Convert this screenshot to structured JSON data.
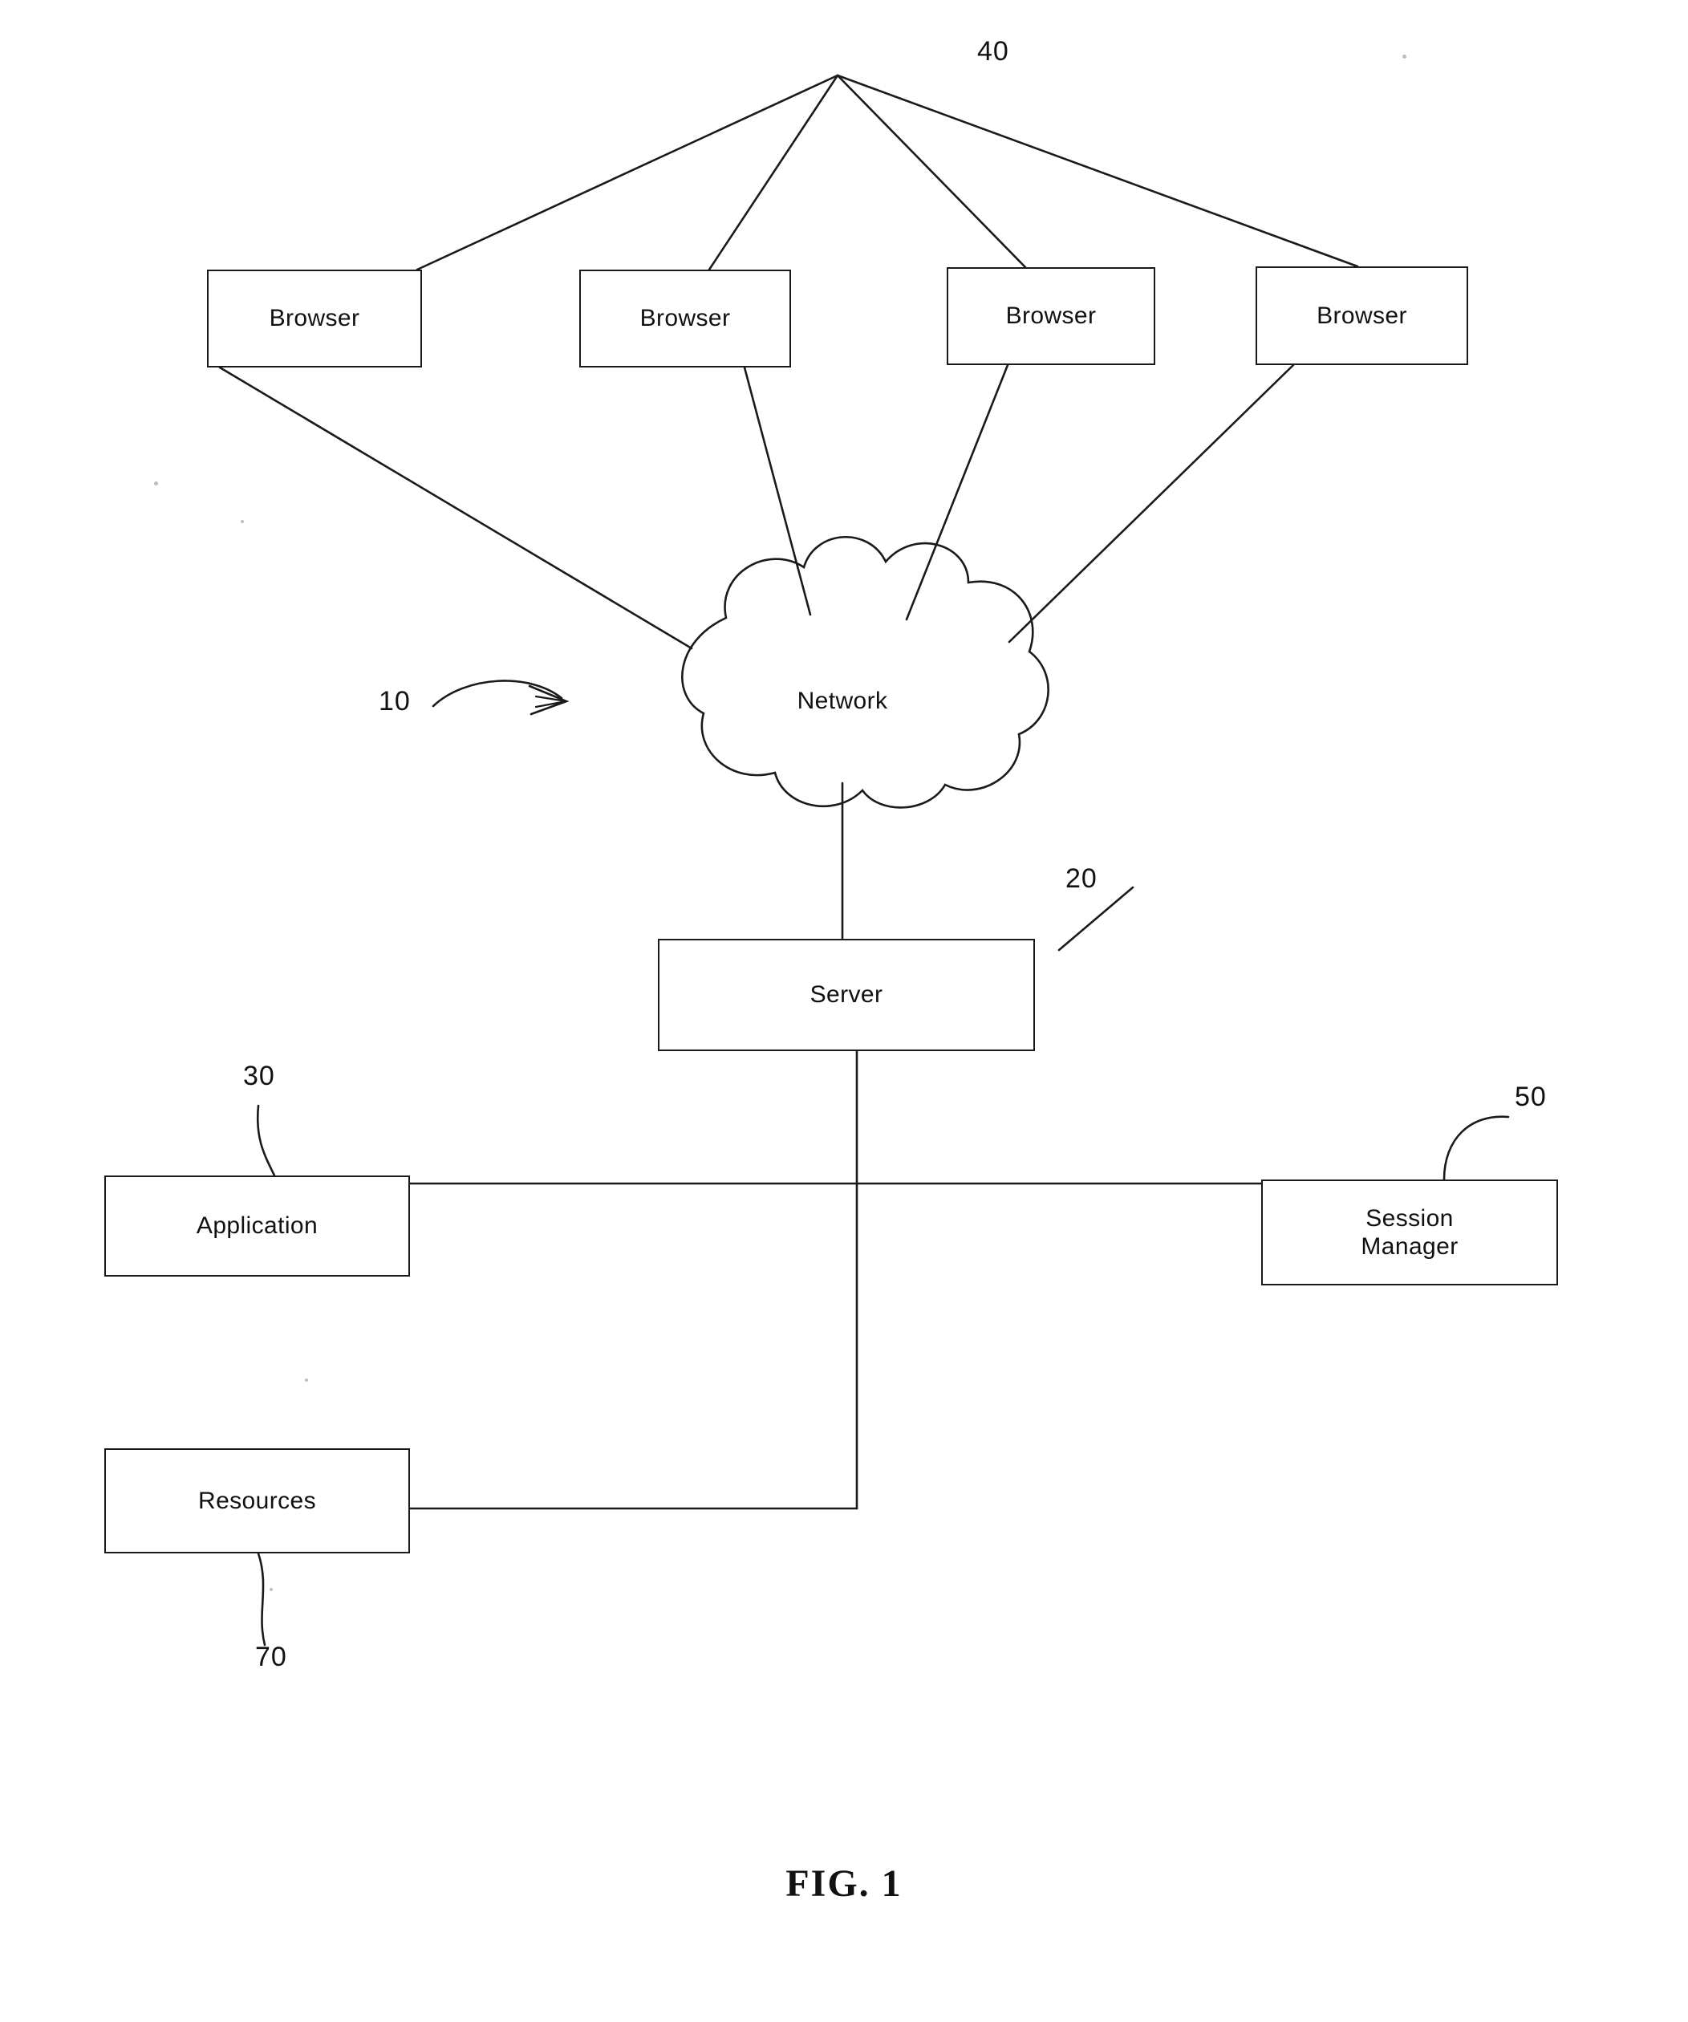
{
  "figure": {
    "caption": "FIG. 1",
    "system_reference": "10"
  },
  "nodes": {
    "browsers": [
      {
        "label": "Browser",
        "reference": ""
      },
      {
        "label": "Browser",
        "reference": ""
      },
      {
        "label": "Browser",
        "reference": ""
      },
      {
        "label": "Browser",
        "reference": ""
      }
    ],
    "browser_group_reference": "40",
    "network": {
      "label": "Network"
    },
    "server": {
      "label": "Server",
      "reference": "20"
    },
    "application": {
      "label": "Application",
      "reference": "30"
    },
    "session_manager": {
      "label": "Session\nManager",
      "reference": "50"
    },
    "resources": {
      "label": "Resources",
      "reference": "70"
    }
  },
  "colors": {
    "line": "#1a1a1a",
    "text": "#111111",
    "background": "#ffffff"
  }
}
